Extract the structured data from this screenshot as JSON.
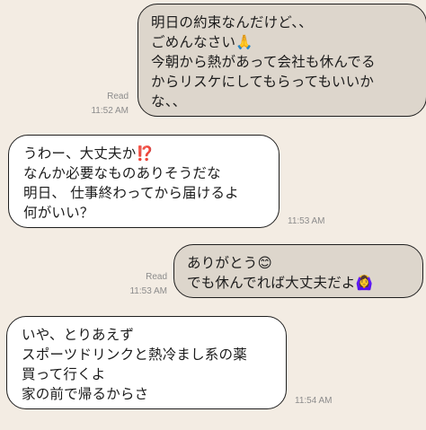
{
  "messages": [
    {
      "direction": "sent",
      "text": "明日の約束なんだけど、、\nごめんなさい🙏\n今朝から熱があって会社も休んでる\nからリスケにしてもらってもいいか\nな、、",
      "read_label": "Read",
      "time": "11:52 AM"
    },
    {
      "direction": "received",
      "text": "うわー、大丈夫か⁉️\nなんか必要なものありそうだな\n明日、 仕事終わってから届けるよ\n何がいい？",
      "time": "11:53 AM"
    },
    {
      "direction": "sent",
      "text": "ありがとう😊\nでも休んでれば大丈夫だよ🙆‍♀️",
      "read_label": "Read",
      "time": "11:53 AM"
    },
    {
      "direction": "received",
      "text": "いや、とりあえず\nスポーツドリンクと熱冷まし系の薬\n買って行くよ\n家の前で帰るからさ",
      "time": "11:54 AM"
    }
  ],
  "colors": {
    "background": "#f3ece3",
    "sent_bubble": "#ddd6cc",
    "received_bubble": "#ffffff",
    "meta_text": "#8c8c8c"
  }
}
